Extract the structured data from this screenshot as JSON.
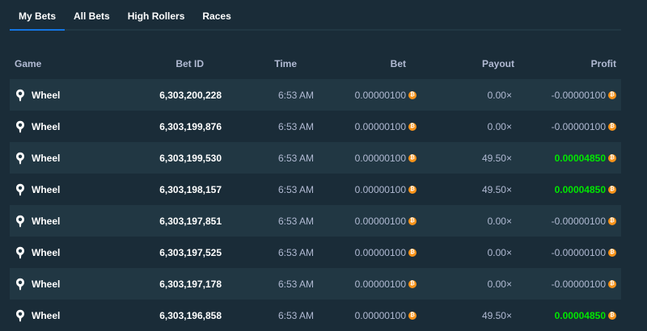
{
  "tabs": [
    {
      "label": "My Bets",
      "active": true
    },
    {
      "label": "All Bets",
      "active": false
    },
    {
      "label": "High Rollers",
      "active": false
    },
    {
      "label": "Races",
      "active": false
    }
  ],
  "columns": {
    "game": "Game",
    "bet_id": "Bet ID",
    "time": "Time",
    "bet": "Bet",
    "payout": "Payout",
    "profit": "Profit"
  },
  "currency_icon": "bitcoin-icon",
  "game_icon": "wheel-icon",
  "colors": {
    "win": "#00e701",
    "currency": "#f7931a",
    "active_tab": "#1475e1"
  },
  "rows": [
    {
      "game": "Wheel",
      "bet_id": "6,303,200,228",
      "time": "6:53 AM",
      "bet": "0.00000100",
      "payout": "0.00×",
      "profit": "-0.00000100",
      "win": false
    },
    {
      "game": "Wheel",
      "bet_id": "6,303,199,876",
      "time": "6:53 AM",
      "bet": "0.00000100",
      "payout": "0.00×",
      "profit": "-0.00000100",
      "win": false
    },
    {
      "game": "Wheel",
      "bet_id": "6,303,199,530",
      "time": "6:53 AM",
      "bet": "0.00000100",
      "payout": "49.50×",
      "profit": "0.00004850",
      "win": true
    },
    {
      "game": "Wheel",
      "bet_id": "6,303,198,157",
      "time": "6:53 AM",
      "bet": "0.00000100",
      "payout": "49.50×",
      "profit": "0.00004850",
      "win": true
    },
    {
      "game": "Wheel",
      "bet_id": "6,303,197,851",
      "time": "6:53 AM",
      "bet": "0.00000100",
      "payout": "0.00×",
      "profit": "-0.00000100",
      "win": false
    },
    {
      "game": "Wheel",
      "bet_id": "6,303,197,525",
      "time": "6:53 AM",
      "bet": "0.00000100",
      "payout": "0.00×",
      "profit": "-0.00000100",
      "win": false
    },
    {
      "game": "Wheel",
      "bet_id": "6,303,197,178",
      "time": "6:53 AM",
      "bet": "0.00000100",
      "payout": "0.00×",
      "profit": "-0.00000100",
      "win": false
    },
    {
      "game": "Wheel",
      "bet_id": "6,303,196,858",
      "time": "6:53 AM",
      "bet": "0.00000100",
      "payout": "49.50×",
      "profit": "0.00004850",
      "win": true
    }
  ]
}
